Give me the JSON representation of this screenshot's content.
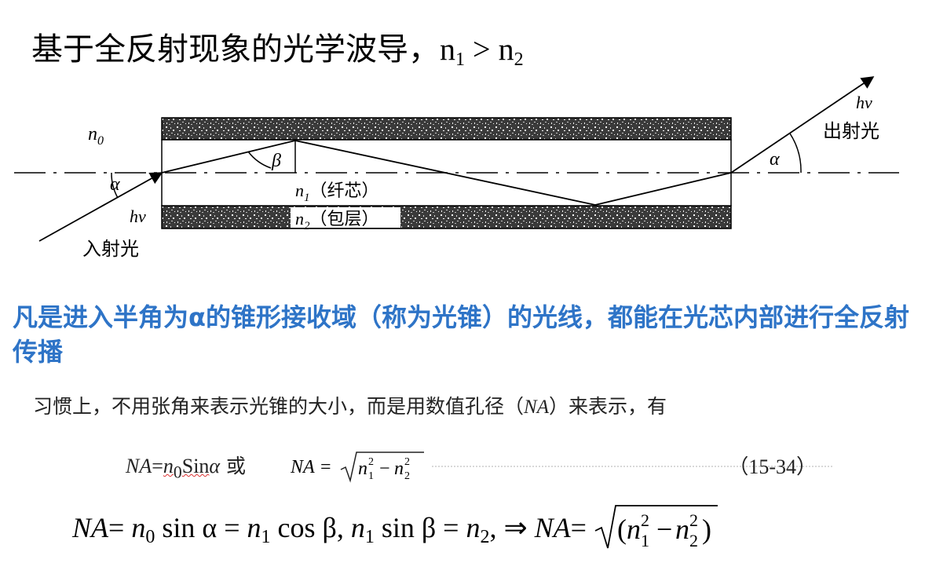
{
  "title": {
    "text": "基于全反射现象的光学波导，",
    "n1": "n",
    "n1_sub": "1",
    "gt": " > ",
    "n2": "n",
    "n2_sub": "2"
  },
  "figure": {
    "n0_label": "n",
    "n0_sub": "0",
    "alpha_left": "α",
    "beta": "β",
    "hv_in": "hν",
    "in_light": "入射光",
    "core_n": "n",
    "core_sub": "1",
    "core_label": "（纤芯）",
    "clad_n": "n",
    "clad_sub": "2",
    "clad_label": "（包层）",
    "hv_out": "hν",
    "out_light": "出射光",
    "alpha_right": "α"
  },
  "statement": "凡是进入半角为α的锥形接收域（称为光锥）的光线，都能在光芯内部进行全反射传播",
  "intro": {
    "before": "习惯上，不用张角来表示光锥的大小，而是用数值孔径（",
    "na": "NA",
    "after": "）来表示，有"
  },
  "formula1": {
    "left_na": "NA",
    "left_eq": "=",
    "left_n0": "n",
    "left_n0_sub": "0",
    "left_sin": "Sin",
    "left_alpha": "α",
    "or": " 或 ",
    "right_na": "NA",
    "right_eq": " = ",
    "eq_number": "（15-34）"
  },
  "formula2": {
    "na": "NA",
    "eq1": "= ",
    "n0": "n",
    "n0_sub": "0",
    "sin_alpha": " sin α = ",
    "n1": "n",
    "n1_sub": "1",
    "cos_beta": " cos β, ",
    "n1b": "n",
    "n1b_sub": "1",
    "sin_beta": " sin β = ",
    "n2": "n",
    "n2_sub": "2",
    "implies": ", ⇒ ",
    "na2": "NA",
    "eq2": "= "
  }
}
